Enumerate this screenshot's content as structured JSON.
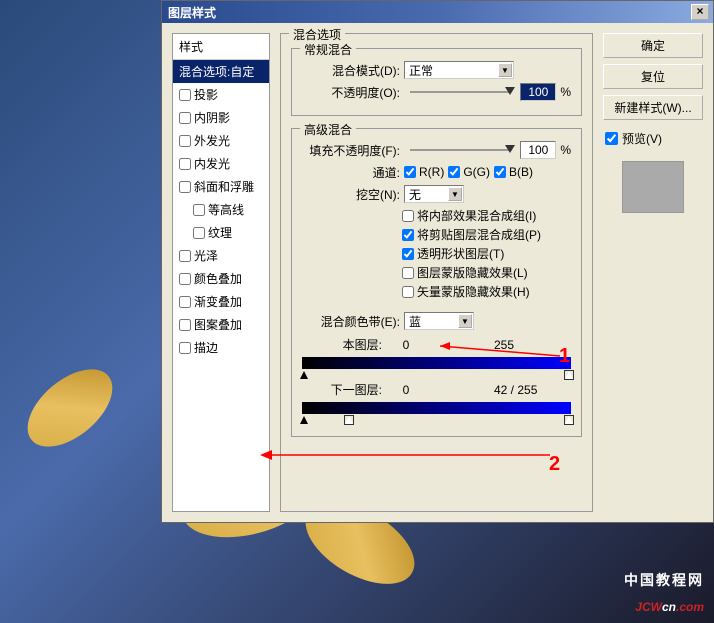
{
  "dialog": {
    "title": "图层样式",
    "close": "×"
  },
  "styles_panel": {
    "header": "样式",
    "items": [
      {
        "label": "混合选项:自定",
        "selected": true,
        "checkbox": false
      },
      {
        "label": "投影",
        "checkbox": true
      },
      {
        "label": "内阴影",
        "checkbox": true
      },
      {
        "label": "外发光",
        "checkbox": true
      },
      {
        "label": "内发光",
        "checkbox": true
      },
      {
        "label": "斜面和浮雕",
        "checkbox": true
      },
      {
        "label": "等高线",
        "checkbox": true,
        "indent": true
      },
      {
        "label": "纹理",
        "checkbox": true,
        "indent": true
      },
      {
        "label": "光泽",
        "checkbox": true
      },
      {
        "label": "颜色叠加",
        "checkbox": true
      },
      {
        "label": "渐变叠加",
        "checkbox": true
      },
      {
        "label": "图案叠加",
        "checkbox": true
      },
      {
        "label": "描边",
        "checkbox": true
      }
    ]
  },
  "blend_options": {
    "title": "混合选项",
    "general": {
      "title": "常规混合",
      "mode_label": "混合模式(D):",
      "mode_value": "正常",
      "opacity_label": "不透明度(O):",
      "opacity_value": "100",
      "opacity_unit": "%"
    },
    "advanced": {
      "title": "高级混合",
      "fill_label": "填充不透明度(F):",
      "fill_value": "100",
      "fill_unit": "%",
      "channels_label": "通道:",
      "channel_r": "R(R)",
      "channel_g": "G(G)",
      "channel_b": "B(B)",
      "knockout_label": "挖空(N):",
      "knockout_value": "无",
      "options": [
        {
          "label": "将内部效果混合成组(I)",
          "checked": false
        },
        {
          "label": "将剪贴图层混合成组(P)",
          "checked": true
        },
        {
          "label": "透明形状图层(T)",
          "checked": true
        },
        {
          "label": "图层蒙版隐藏效果(L)",
          "checked": false
        },
        {
          "label": "矢量蒙版隐藏效果(H)",
          "checked": false
        }
      ]
    },
    "blend_if": {
      "label": "混合颜色带(E):",
      "value": "蓝",
      "this_layer_label": "本图层:",
      "this_layer_min": "0",
      "this_layer_max": "255",
      "underlying_label": "下一图层:",
      "underlying_min": "0",
      "underlying_split": "42 / 255",
      "underlying_max": ""
    }
  },
  "buttons": {
    "ok": "确定",
    "cancel": "复位",
    "new_style": "新建样式(W)...",
    "preview": "预览(V)"
  },
  "annotations": {
    "one": "1",
    "two": "2"
  },
  "watermark": {
    "line1": "中国教程网",
    "line2_a": "JCW",
    "line2_b": "cn",
    "line2_c": ".com"
  }
}
